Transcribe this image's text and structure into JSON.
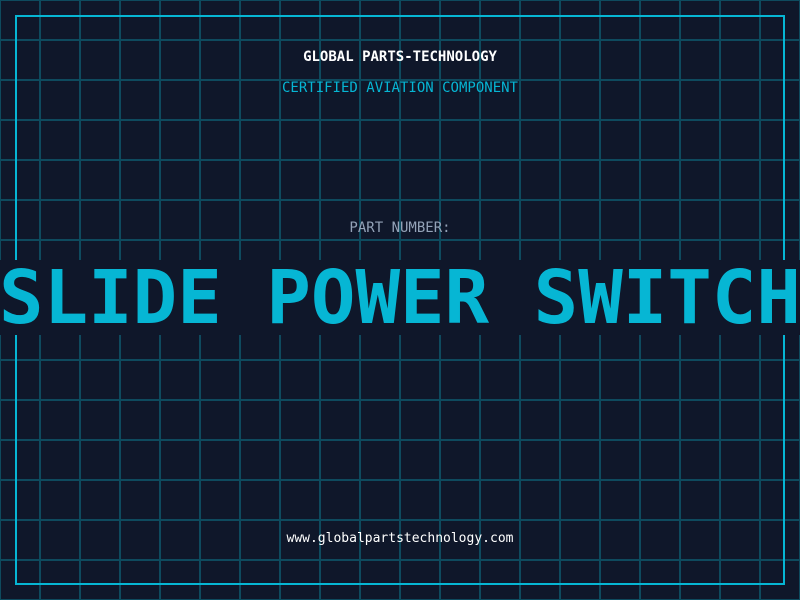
{
  "header": {
    "title": "GLOBAL PARTS-TECHNOLOGY",
    "subtitle": "CERTIFIED AVIATION COMPONENT"
  },
  "part": {
    "label": "PART NUMBER:",
    "name": "SLIDE POWER SWITCH"
  },
  "footer": {
    "url": "www.globalpartstechnology.com"
  },
  "colors": {
    "background": "#0f172a",
    "grid": "#0e4a5e",
    "accent": "#06b6d4",
    "text": "#ffffff",
    "muted": "#94a3b8"
  }
}
